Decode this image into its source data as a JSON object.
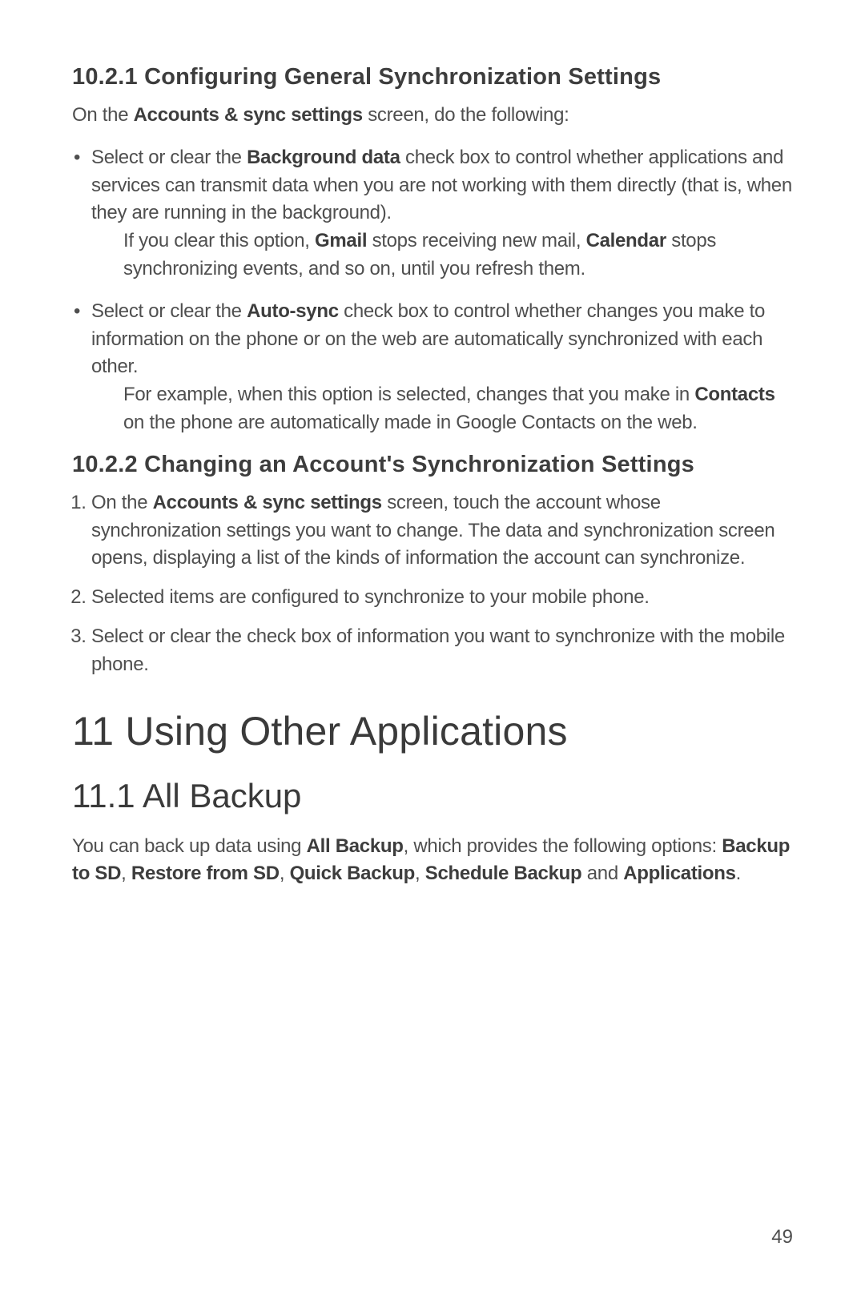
{
  "sections": {
    "s10_2_1": {
      "heading": "10.2.1  Configuring General Synchronization Settings",
      "intro_pre": "On the ",
      "intro_bold": "Accounts & sync settings",
      "intro_post": " screen, do the following:",
      "bullet1_pre": "Select or clear the ",
      "bullet1_bold": "Background data",
      "bullet1_post": " check box to control whether applications and services can transmit data when you are not working with them directly (that is, when they are running in the background).",
      "note1_pre": "If you clear this option, ",
      "note1_b1": "Gmail",
      "note1_mid": " stops receiving new mail, ",
      "note1_b2": "Calendar",
      "note1_post": " stops synchronizing events, and so on, until you refresh them.",
      "bullet2_pre": "Select or clear the ",
      "bullet2_bold": "Auto-sync",
      "bullet2_post": " check box to control whether changes you make to information on the phone or on the web are automatically synchronized with each other.",
      "note2_pre": "For example, when this option is selected, changes that you make in ",
      "note2_b1": "Contacts",
      "note2_post": " on the phone are automatically made in Google Contacts on the web."
    },
    "s10_2_2": {
      "heading": "10.2.2  Changing an Account's Synchronization Settings",
      "step1_pre": "On the ",
      "step1_bold": "Accounts & sync settings",
      "step1_post": " screen, touch the account whose synchronization settings you want to change. The data and synchronization screen opens, displaying a list of the kinds of information the account can synchronize.",
      "step2": "Selected items are configured to synchronize to your mobile phone.",
      "step3": "Select or clear the check box of information you want to synchronize with the mobile phone."
    },
    "s11": {
      "heading": "11  Using Other Applications"
    },
    "s11_1": {
      "heading": "11.1  All Backup",
      "p1_pre": "You can back up data using ",
      "p1_b1": "All Backup",
      "p1_mid1": ", which provides the following options: ",
      "p1_b2": "Backup to SD",
      "p1_mid2": ", ",
      "p1_b3": "Restore from SD",
      "p1_mid3": ", ",
      "p1_b4": "Quick Backup",
      "p1_mid4": ", ",
      "p1_b5": "Schedule Backup",
      "p1_mid5": " and ",
      "p1_b6": "Applications",
      "p1_post": "."
    }
  },
  "page_number": "49"
}
